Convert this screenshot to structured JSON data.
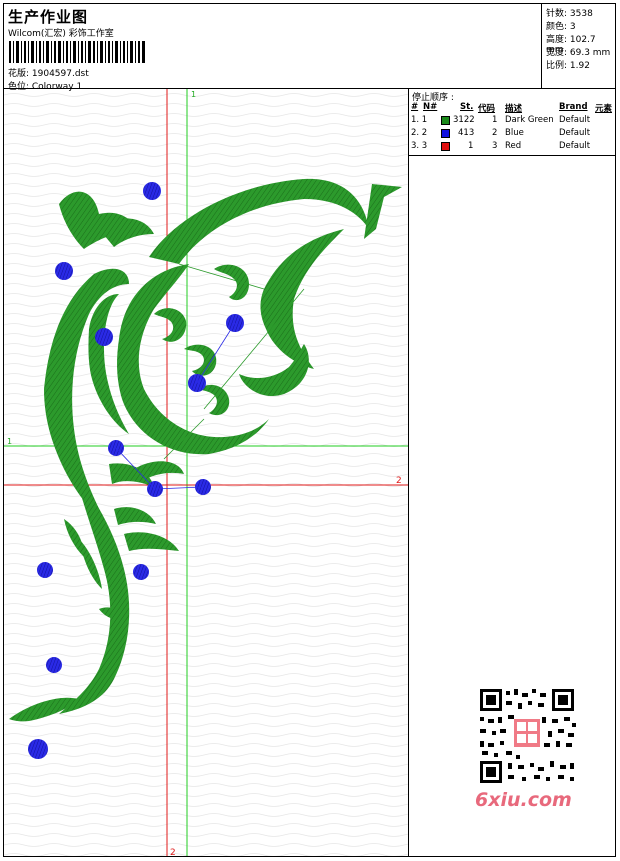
{
  "header": {
    "title": "生产作业图",
    "subtitle": "Wilcom(汇宏) 彩饰工作室",
    "design": "花版: 1904597.dst",
    "colorway": "色位: Colorway 1"
  },
  "info": {
    "stitches": "针数: 3538",
    "colors": "颜色: 3",
    "height": "高度: 102.7 mm",
    "width": "宽度: 69.3 mm",
    "ratio": "比例: 1.92"
  },
  "canvas": {
    "axis_1_top": "1",
    "axis_1_left": "1",
    "axis_2_right": "2",
    "axis_2_bottom": "2"
  },
  "stop_sequence": {
    "title": "停止顺序 :",
    "headers": [
      "#",
      "N#",
      "St.",
      "代码",
      "描述",
      "Brand",
      "元素"
    ],
    "rows": [
      {
        "index": "1. 1",
        "color": "#1a8a1a",
        "stitches": "3122",
        "code": "1",
        "desc": "Dark Green",
        "brand": "Default"
      },
      {
        "index": "2. 2",
        "color": "#1010e0",
        "stitches": "413",
        "code": "2",
        "desc": "Blue",
        "brand": "Default"
      },
      {
        "index": "3. 3",
        "color": "#e01010",
        "stitches": "1",
        "code": "3",
        "desc": "Red",
        "brand": "Default"
      }
    ]
  },
  "watermark": {
    "site": "6xiu.com"
  },
  "colors": {
    "green": "#1f9a1f",
    "blue": "#1a1ae0",
    "red": "#e01a1a",
    "guide": "#22cc22"
  }
}
